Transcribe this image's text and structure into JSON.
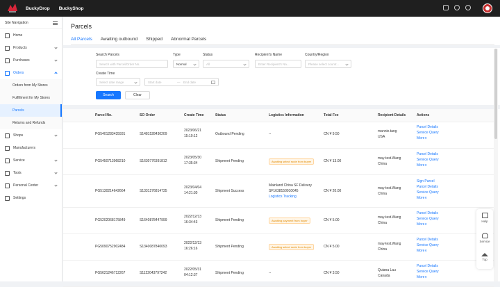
{
  "topbar": {
    "brand1": "BuckyDrop",
    "brand2": "BuckyShop"
  },
  "sidebar": {
    "title": "Site Navigation",
    "items": [
      {
        "label": "Home"
      },
      {
        "label": "Products"
      },
      {
        "label": "Purchases"
      },
      {
        "label": "Orders"
      },
      {
        "label": "Orders from My Stores"
      },
      {
        "label": "Fulfillment for My Stores"
      },
      {
        "label": "Parcels"
      },
      {
        "label": "Returns and Refunds"
      },
      {
        "label": "Shops"
      },
      {
        "label": "Manufacturers"
      },
      {
        "label": "Service"
      },
      {
        "label": "Tools"
      },
      {
        "label": "Personal Center"
      },
      {
        "label": "Settings"
      }
    ]
  },
  "page": {
    "title": "Parcels"
  },
  "tabs": [
    "All Parcels",
    "Awaiting outbound",
    "Shipped",
    "Abnormal Parcels"
  ],
  "filters": {
    "search_label": "Search Parcels",
    "search_placeholder": "Search with Parcel/Order No.",
    "type_label": "Type",
    "type_value": "Normal",
    "status_label": "Status",
    "status_value": "All",
    "recipient_label": "Recipient's Name",
    "recipient_placeholder": "Enter Recipient's Na...",
    "country_label": "Country/Region",
    "country_placeholder": "Please select countr...",
    "create_time_label": "Create Time",
    "date_range_placeholder": "Select date range",
    "start_date": "Start date",
    "date_sep": "—",
    "end_date": "End date",
    "search_btn": "Search",
    "clear_btn": "Clear"
  },
  "table": {
    "headers": [
      "Parcel No.",
      "SO Order",
      "Create Time",
      "Status",
      "Logistics Information",
      "Total Fee",
      "Recipient Details",
      "Actions"
    ],
    "rows": [
      {
        "parcel": "PG5401283435931",
        "so": "S1481528430209",
        "time1": "2023/06/21",
        "time2": "15:10:12",
        "status": "Outbound Pending",
        "logistics": "--",
        "fee": "CN ¥ 9.50",
        "r1": "mannie.tang",
        "r2": "USA",
        "actions": [
          "Parcel Details",
          "Service Query",
          "More∨"
        ]
      },
      {
        "parcel": "PG5450713968210",
        "so": "S1630776391812",
        "time1": "2023/05/30",
        "time2": "17:35:34",
        "status": "Shipment Pending",
        "badge": "Awaiting select route from buyer",
        "fee": "CN ¥ 13.00",
        "r1": "may-test.Wang",
        "r2": "China",
        "actions": [
          "Parcel Details",
          "Service Query",
          "More∨"
        ]
      },
      {
        "parcel": "PG5130214642664",
        "so": "S1331276814735",
        "time1": "2023/04/04",
        "time2": "14:21:30",
        "status": "Shipment Success",
        "logistics": "Mainland China SF Delivery",
        "logistics2": "SF1638150910045",
        "logistics3": "Logistics Tracking",
        "fee": "CN ¥ 20.00",
        "r1": "may-test.Wang",
        "r2": "China",
        "actions": [
          "Sign Parcel",
          "Parcel Details",
          "Service Query",
          "More∨"
        ]
      },
      {
        "parcel": "PG5202068175849",
        "so": "S1640878447999",
        "time1": "2022/12/13",
        "time2": "16:34:43",
        "status": "Shipment Pending",
        "badge": "Awaiting payment from buyer",
        "fee": "CN ¥ 5.00",
        "r1": "may-test.Wang",
        "r2": "China",
        "actions": [
          "Parcel Details",
          "Service Query",
          "More∨"
        ]
      },
      {
        "parcel": "PG5090752902484",
        "so": "S1340087840093",
        "time1": "2022/12/13",
        "time2": "16:26:16",
        "status": "Shipment Pending",
        "badge": "Awaiting select route from buyer",
        "fee": "CN ¥ 5.00",
        "r1": "may-test.Wang",
        "r2": "China",
        "actions": [
          "Parcel Details",
          "Service Query",
          "More∨"
        ]
      },
      {
        "parcel": "PG5621246712267",
        "so": "S1122043797242",
        "time1": "2022/05/31",
        "time2": "04:12:37",
        "status": "Shipment Pending",
        "logistics": "--",
        "fee": "CN ¥ 3.50",
        "r1": "Quiana Lau",
        "r2": "Canada",
        "actions": [
          "Parcel Details",
          "Service Query",
          "More∨"
        ]
      }
    ]
  },
  "float": {
    "help": "Help",
    "service": "Service",
    "top": "Top"
  }
}
